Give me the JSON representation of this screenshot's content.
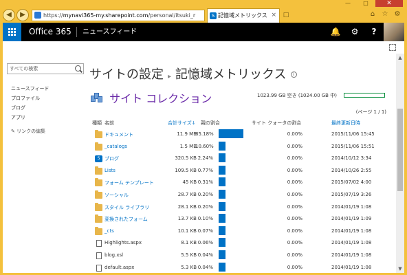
{
  "browser": {
    "url_prefix": "https://",
    "url_host": "mynavi365-my.sharepoint.com",
    "url_path": "/personal/itsuki_r",
    "tab_title": "記憶域メトリックス",
    "tab_icon": "S",
    "back_icon": "back-arrow-icon",
    "forward_icon": "forward-arrow-icon",
    "window_controls": [
      "—",
      "□",
      "✕"
    ],
    "toolbar_icons": [
      "home-icon",
      "star-icon",
      "gear-icon"
    ]
  },
  "suitebar": {
    "brand": "Office 365",
    "app_title": "ニュースフィード",
    "icons": [
      "bell-icon",
      "gear-icon",
      "help-icon"
    ]
  },
  "leftnav": {
    "search_placeholder": "すべての検索",
    "items": [
      "ニュースフィード",
      "プロファイル",
      "ブログ",
      "アプリ"
    ],
    "edit_links": "リンクの編集"
  },
  "page": {
    "title_parent": "サイトの設定",
    "title_current": "記憶域メトリックス",
    "section_title": "サイト コレクション",
    "quota_text": "1023.99 GB 空き (1024.00 GB 中)",
    "quota_used_fraction": 0.0,
    "pager": "(ページ 1 / 1)"
  },
  "table": {
    "headers": {
      "type": "種類",
      "name": "名前",
      "total_size": "合計サイズ↓",
      "parent_pct": "親の割合",
      "quota_pct": "サイト クォータの割合",
      "last_modified": "最終更新日時"
    },
    "rows": [
      {
        "icon": "folder",
        "name": "ドキュメント",
        "size": "11.9 MB",
        "pct": "85.18%",
        "pct_value": 85.18,
        "qpct": "0.00%",
        "date": "2015/11/06 15:45",
        "link": true
      },
      {
        "icon": "folder",
        "name": "_catalogs",
        "size": "1.5 MB",
        "pct": "10.60%",
        "pct_value": 10.6,
        "qpct": "0.00%",
        "date": "2015/11/06 15:51",
        "link": true
      },
      {
        "icon": "sp",
        "name": "ブログ",
        "size": "320.5 KB",
        "pct": "2.24%",
        "pct_value": 2.24,
        "qpct": "0.00%",
        "date": "2014/10/12 3:34",
        "link": true
      },
      {
        "icon": "folder",
        "name": "Lists",
        "size": "109.5 KB",
        "pct": "0.77%",
        "pct_value": 0.77,
        "qpct": "0.00%",
        "date": "2014/10/26 2:55",
        "link": true
      },
      {
        "icon": "folder",
        "name": "フォーム テンプレート",
        "size": "45 KB",
        "pct": "0.31%",
        "pct_value": 0.31,
        "qpct": "0.00%",
        "date": "2015/07/02 4:00",
        "link": true
      },
      {
        "icon": "folder",
        "name": "ソーシャル",
        "size": "28.7 KB",
        "pct": "0.20%",
        "pct_value": 0.2,
        "qpct": "0.00%",
        "date": "2015/07/19 3:26",
        "link": true
      },
      {
        "icon": "folder",
        "name": "スタイル ライブラリ",
        "size": "28.1 KB",
        "pct": "0.20%",
        "pct_value": 0.2,
        "qpct": "0.00%",
        "date": "2014/01/19 1:08",
        "link": true
      },
      {
        "icon": "folder",
        "name": "変換されたフォーム",
        "size": "13.7 KB",
        "pct": "0.10%",
        "pct_value": 0.1,
        "qpct": "0.00%",
        "date": "2014/01/19 1:09",
        "link": true
      },
      {
        "icon": "folder",
        "name": "_cts",
        "size": "10.1 KB",
        "pct": "0.07%",
        "pct_value": 0.07,
        "qpct": "0.00%",
        "date": "2014/01/19 1:08",
        "link": true
      },
      {
        "icon": "file",
        "name": "Highlights.aspx",
        "size": "8.1 KB",
        "pct": "0.06%",
        "pct_value": 0.06,
        "qpct": "0.00%",
        "date": "2014/01/19 1:08",
        "link": false
      },
      {
        "icon": "file",
        "name": "blog.xsl",
        "size": "5.5 KB",
        "pct": "0.04%",
        "pct_value": 0.04,
        "qpct": "0.00%",
        "date": "2014/01/19 1:08",
        "link": false
      },
      {
        "icon": "file",
        "name": "default.aspx",
        "size": "5.3 KB",
        "pct": "0.04%",
        "pct_value": 0.04,
        "qpct": "0.00%",
        "date": "2014/01/19 1:08",
        "link": false
      }
    ]
  },
  "colors": {
    "accent": "#0072c6",
    "section_title": "#6a2aa8",
    "quota_bar": "#0a8f3e"
  }
}
